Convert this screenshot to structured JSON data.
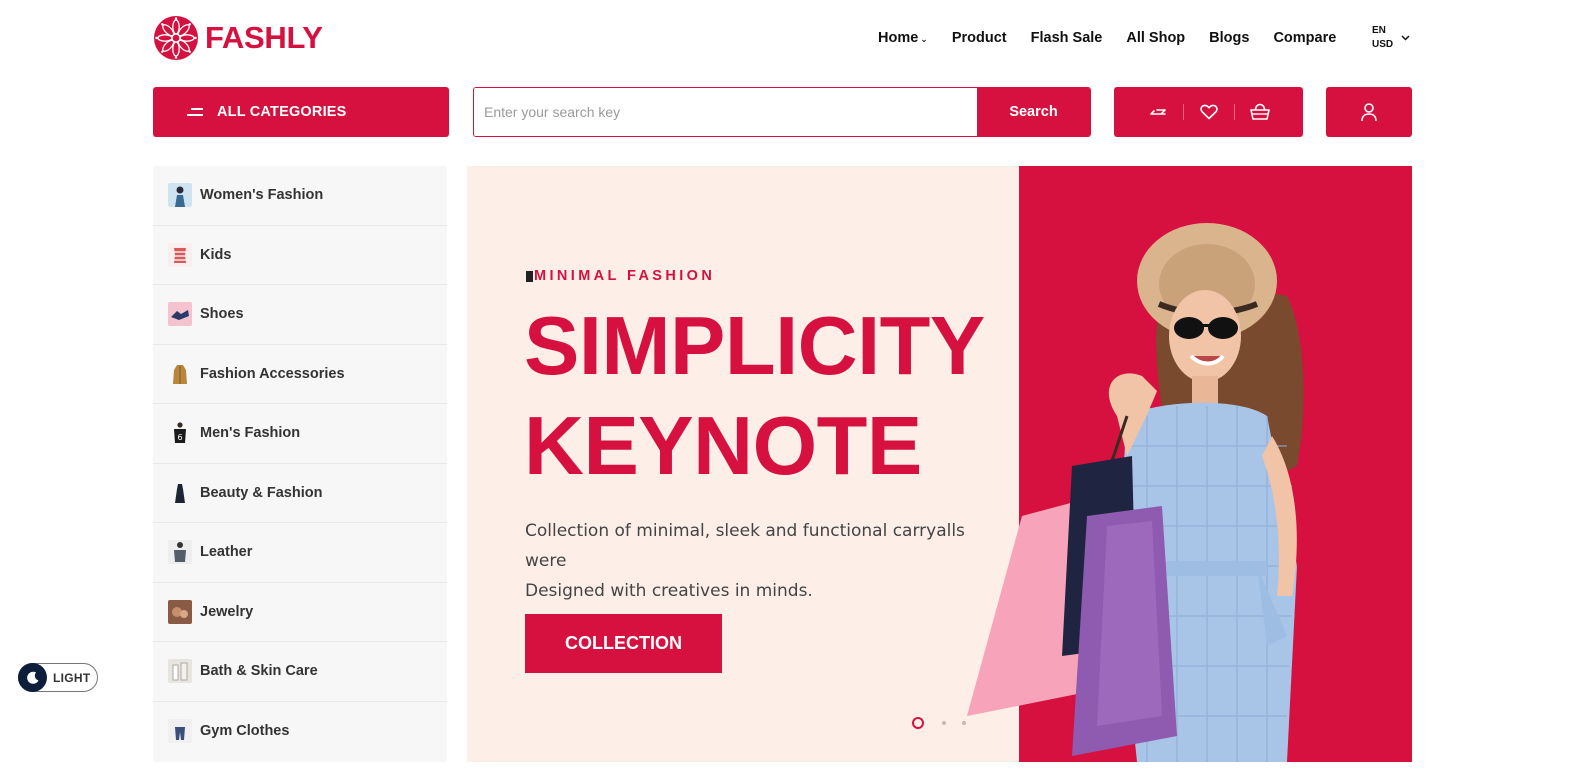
{
  "brand": {
    "name": "FASHLY",
    "color": "#d6103f"
  },
  "nav": {
    "items": [
      {
        "label": "Home",
        "has_dropdown": true
      },
      {
        "label": "Product"
      },
      {
        "label": "Flash Sale"
      },
      {
        "label": "All Shop"
      },
      {
        "label": "Blogs"
      },
      {
        "label": "Compare"
      }
    ],
    "language": "EN",
    "currency": "USD"
  },
  "categories_button": {
    "label": "ALL CATEGORIES",
    "icon": "menu-icon"
  },
  "search": {
    "placeholder": "Enter your search key",
    "value": "",
    "button_label": "Search"
  },
  "header_actions": {
    "icons": [
      "compare-icon",
      "heart-icon",
      "basket-icon",
      "user-icon"
    ]
  },
  "sidebar": {
    "items": [
      {
        "label": "Women's Fashion"
      },
      {
        "label": "Kids"
      },
      {
        "label": "Shoes"
      },
      {
        "label": "Fashion Accessories"
      },
      {
        "label": "Men's Fashion"
      },
      {
        "label": "Beauty & Fashion"
      },
      {
        "label": "Leather"
      },
      {
        "label": "Jewelry"
      },
      {
        "label": "Bath & Skin Care"
      },
      {
        "label": "Gym Clothes"
      }
    ]
  },
  "hero": {
    "tagline": "MINIMAL FASHION",
    "title_line1": "SIMPLICITY",
    "title_line2": "KEYNOTE",
    "description_line1": "Collection of minimal, sleek and functional carryalls were",
    "description_line2": "Designed with creatives in minds.",
    "button_label": "COLLECTION",
    "slides_total": 3,
    "active_slide": 1,
    "bg_color": "#fdefe8"
  },
  "theme_toggle": {
    "label": "LIGHT",
    "icon": "moon-icon"
  }
}
